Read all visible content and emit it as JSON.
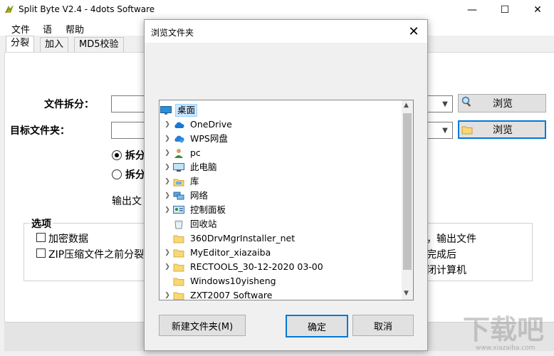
{
  "window": {
    "title": "Split Byte V2.4 - 4dots Software",
    "minimize": "—",
    "maximize": "☐",
    "close": "✕"
  },
  "menu": [
    "文件",
    "语",
    "帮助"
  ],
  "tabs": [
    "分裂",
    "加入",
    "MD5校验"
  ],
  "form": {
    "split_file_label": "文件拆分：",
    "target_folder_label": "目标文件夹：",
    "browse_label": "浏览",
    "radio1": "拆分",
    "radio2": "拆分",
    "output_label": "输出文"
  },
  "options": {
    "title": "选项",
    "encrypt": "加密数据",
    "zip": "ZIP压缩文件之前分裂",
    "right1": "，输出文件",
    "right2": "完成后",
    "right3": "闭计算机"
  },
  "dialog": {
    "title": "浏览文件夹",
    "close": "✕",
    "tree": [
      {
        "label": "桌面",
        "icon": "desktop-icon",
        "expandable": false,
        "selected": true,
        "indent": 0
      },
      {
        "label": "OneDrive",
        "icon": "cloud-icon",
        "expandable": true,
        "selected": false,
        "indent": 1
      },
      {
        "label": "WPS网盘",
        "icon": "cloud-sync-icon",
        "expandable": true,
        "selected": false,
        "indent": 1
      },
      {
        "label": "pc",
        "icon": "user-icon",
        "expandable": true,
        "selected": false,
        "indent": 1
      },
      {
        "label": "此电脑",
        "icon": "computer-icon",
        "expandable": true,
        "selected": false,
        "indent": 1
      },
      {
        "label": "库",
        "icon": "library-icon",
        "expandable": true,
        "selected": false,
        "indent": 1
      },
      {
        "label": "网络",
        "icon": "network-icon",
        "expandable": true,
        "selected": false,
        "indent": 1
      },
      {
        "label": "控制面板",
        "icon": "control-panel-icon",
        "expandable": true,
        "selected": false,
        "indent": 1
      },
      {
        "label": "回收站",
        "icon": "recycle-bin-icon",
        "expandable": false,
        "selected": false,
        "indent": 1
      },
      {
        "label": "360DrvMgrInstaller_net",
        "icon": "folder-icon",
        "expandable": false,
        "selected": false,
        "indent": 1
      },
      {
        "label": "MyEditor_xiazaiba",
        "icon": "folder-icon",
        "expandable": true,
        "selected": false,
        "indent": 1
      },
      {
        "label": "RECTOOLS_30-12-2020 03-00",
        "icon": "folder-icon",
        "expandable": true,
        "selected": false,
        "indent": 1
      },
      {
        "label": "Windows10yisheng",
        "icon": "folder-icon",
        "expandable": false,
        "selected": false,
        "indent": 1
      },
      {
        "label": "ZXT2007 Software",
        "icon": "folder-icon",
        "expandable": true,
        "selected": false,
        "indent": 1
      }
    ],
    "new_folder": "新建文件夹(M)",
    "ok": "确定",
    "cancel": "取消"
  },
  "watermark": "下载吧",
  "watermark_url": "www.xiazaiba.com"
}
